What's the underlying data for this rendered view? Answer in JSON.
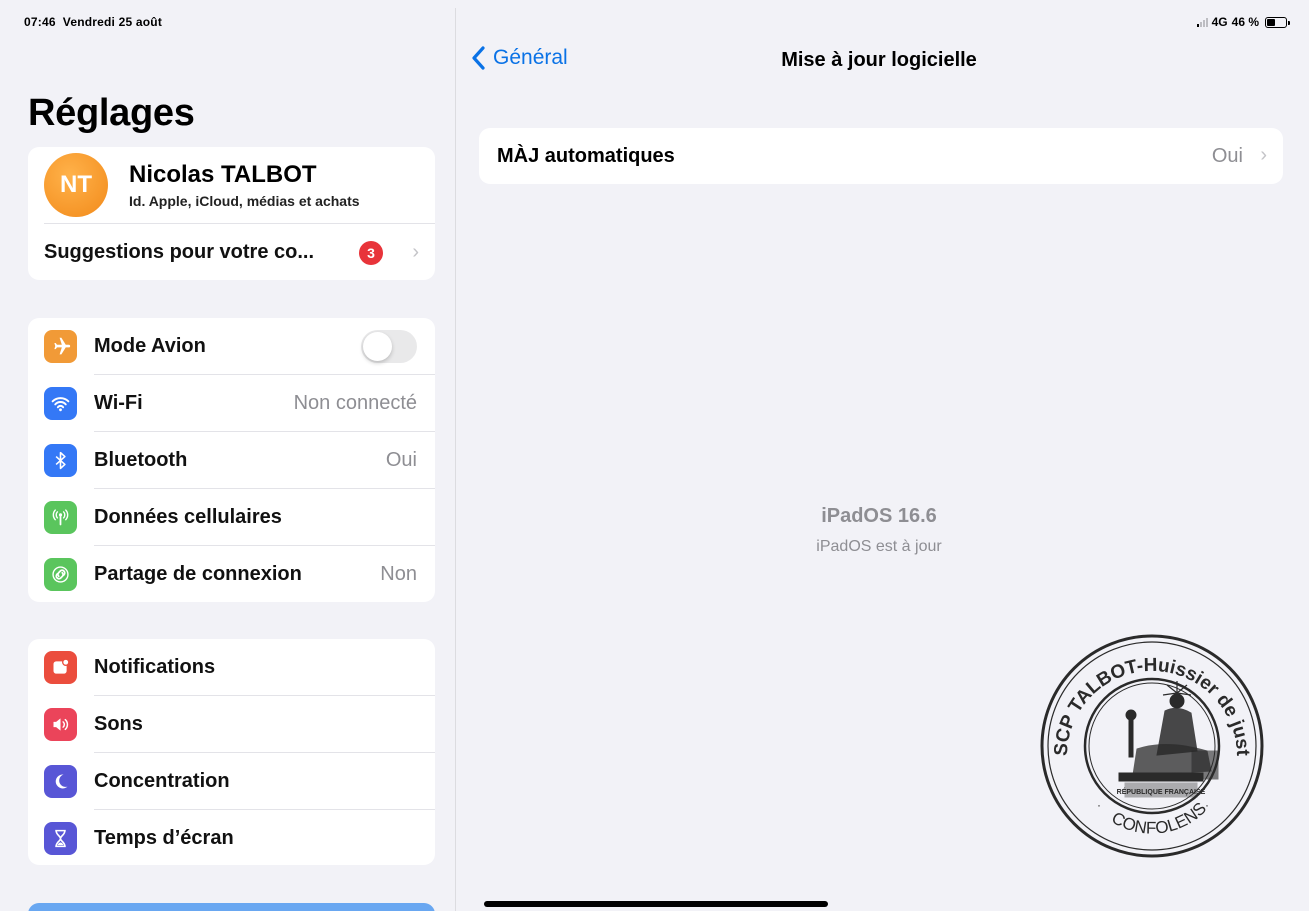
{
  "status_bar": {
    "time": "07:46",
    "date": "Vendredi 25 août",
    "network": "4G",
    "battery_percent": "46 %",
    "battery_level": 0.46
  },
  "sidebar": {
    "title": "Réglages",
    "profile": {
      "initials": "NT",
      "name": "Nicolas TALBOT",
      "subtitle": "Id. Apple, iCloud, médias et achats",
      "suggestions_label": "Suggestions pour votre co...",
      "suggestions_count": "3"
    },
    "connectivity": [
      {
        "label": "Mode Avion",
        "value": "",
        "icon": "airplane-icon",
        "color": "#f19a37",
        "toggle_on": false
      },
      {
        "label": "Wi-Fi",
        "value": "Non connecté",
        "icon": "wifi-icon",
        "color": "#3478f6"
      },
      {
        "label": "Bluetooth",
        "value": "Oui",
        "icon": "bluetooth-icon",
        "color": "#3478f6"
      },
      {
        "label": "Données cellulaires",
        "value": "",
        "icon": "cellular-icon",
        "color": "#5ac55d"
      },
      {
        "label": "Partage de connexion",
        "value": "Non",
        "icon": "hotspot-icon",
        "color": "#5ac55d"
      }
    ],
    "notifications_group": [
      {
        "label": "Notifications",
        "icon": "notifications-icon",
        "color": "#eb4d3d"
      },
      {
        "label": "Sons",
        "icon": "sound-icon",
        "color": "#eb445a"
      },
      {
        "label": "Concentration",
        "icon": "moon-icon",
        "color": "#5856d6"
      },
      {
        "label": "Temps d’écran",
        "icon": "hourglass-icon",
        "color": "#5856d6"
      }
    ]
  },
  "detail": {
    "back_label": "Général",
    "title": "Mise à jour logicielle",
    "auto_update": {
      "label": "MÀJ automatiques",
      "value": "Oui"
    },
    "os_version": "iPadOS 16.6",
    "os_status": "iPadOS est à jour"
  },
  "stamp": {
    "top_text": "SCP TALBOT-Huissier de justice associé",
    "bottom_text": "CONFOLENS",
    "inner_text": "RÉPUBLIQUE FRANÇAISE",
    "color": "#2a2a2a"
  }
}
